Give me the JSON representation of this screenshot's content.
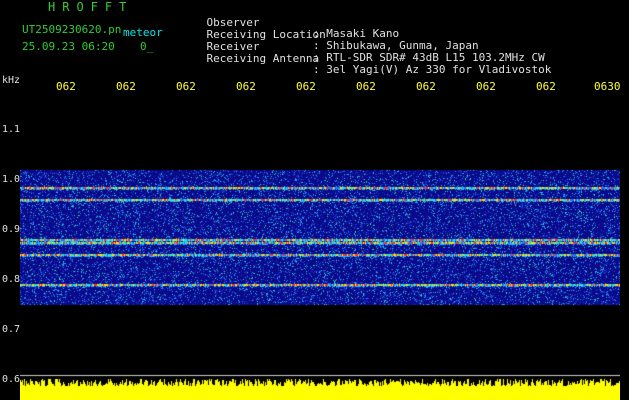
{
  "header": {
    "brand": "HROFFT",
    "filename": "UT2509230620.pn",
    "meteor_label": "meteor",
    "datetime": "25.09.23 06:20",
    "flag": "0_"
  },
  "meta": [
    {
      "label": "Observer",
      "value": ": Masaki Kano"
    },
    {
      "label": "Receiving Location",
      "value": ": Shibukawa, Gunma, Japan"
    },
    {
      "label": "Receiver",
      "value": ": RTL-SDR SDR# 43dB L15 103.2MHz CW"
    },
    {
      "label": "Receiving Antenna",
      "value": ": 3el Yagi(V) Az 330 for Vladivostok"
    }
  ],
  "axis": {
    "unit": "kHz",
    "y_ticks": [
      "1.1",
      "1.0",
      "0.9",
      "0.8",
      "0.7",
      "0.6"
    ],
    "x_ticks": [
      "062",
      "062",
      "062",
      "062",
      "062",
      "062",
      "062",
      "062",
      "062",
      "0630"
    ]
  },
  "colors": {
    "header_green": "#33cc33",
    "header_cyan": "#00e8e8",
    "meta_label": "#e0e0e0",
    "meta_value": "#e0e0e0",
    "tick_y": "#e0e0e0",
    "tick_x": "#ffff33",
    "spectrum_bg": "#0a0a8a",
    "noise_bar": "#ffff00"
  },
  "chart_data": {
    "type": "heatmap",
    "y_unit": "kHz",
    "y_range": [
      0.6,
      1.15
    ],
    "noise_band_khz": [
      0.75,
      1.02
    ],
    "signal_lines_khz": [
      0.985,
      0.96,
      0.88,
      0.875,
      0.85,
      0.79
    ]
  }
}
